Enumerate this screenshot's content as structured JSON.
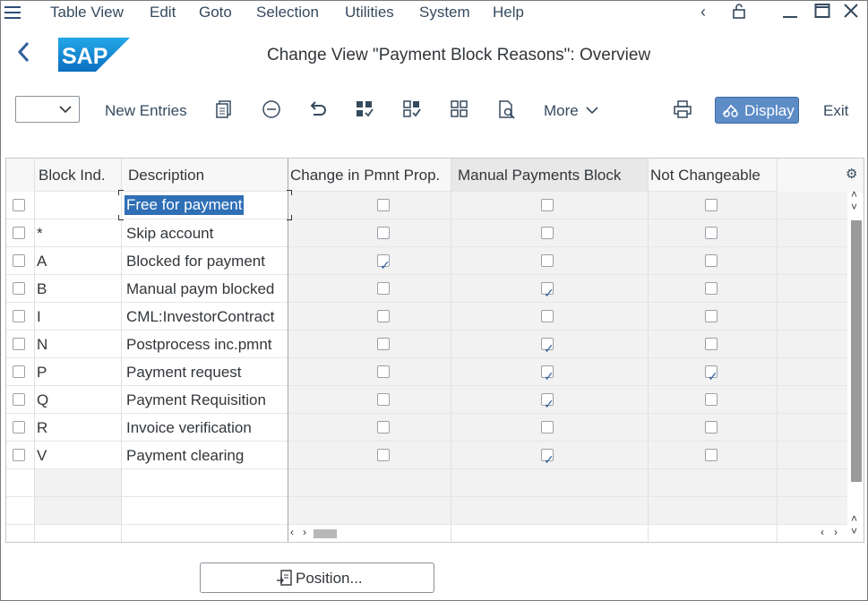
{
  "menu": {
    "items": [
      "Table View",
      "Edit",
      "Goto",
      "Selection",
      "Utilities",
      "System",
      "Help"
    ]
  },
  "titlebar": {
    "title": "Change View \"Payment Block Reasons\": Overview",
    "logo_text": "SAP"
  },
  "toolbar": {
    "new_entries": "New Entries",
    "more": "More",
    "display": "Display",
    "exit": "Exit"
  },
  "table": {
    "columns": [
      "Block Ind.",
      "Description",
      "Change in Pmnt Prop.",
      "Manual Payments Block",
      "Not Changeable"
    ],
    "rows": [
      {
        "ind": "",
        "desc": "Free for payment",
        "change": false,
        "manual": false,
        "notchg": false
      },
      {
        "ind": "*",
        "desc": "Skip account",
        "change": false,
        "manual": false,
        "notchg": false
      },
      {
        "ind": "A",
        "desc": "Blocked for payment",
        "change": true,
        "manual": false,
        "notchg": false
      },
      {
        "ind": "B",
        "desc": "Manual paym blocked",
        "change": false,
        "manual": true,
        "notchg": false
      },
      {
        "ind": "I",
        "desc": "CML:InvestorContract",
        "change": false,
        "manual": false,
        "notchg": false
      },
      {
        "ind": "N",
        "desc": "Postprocess inc.pmnt",
        "change": false,
        "manual": true,
        "notchg": false
      },
      {
        "ind": "P",
        "desc": "Payment request",
        "change": false,
        "manual": true,
        "notchg": true
      },
      {
        "ind": "Q",
        "desc": "Payment Requisition",
        "change": false,
        "manual": true,
        "notchg": false
      },
      {
        "ind": "R",
        "desc": "Invoice verification",
        "change": false,
        "manual": false,
        "notchg": false
      },
      {
        "ind": "V",
        "desc": "Payment clearing",
        "change": false,
        "manual": true,
        "notchg": false
      }
    ]
  },
  "footer": {
    "position_button": "Position..."
  },
  "colors": {
    "accent": "#5d8cc7",
    "selection": "#2f6fb6",
    "brand": "#1a8fd6"
  }
}
